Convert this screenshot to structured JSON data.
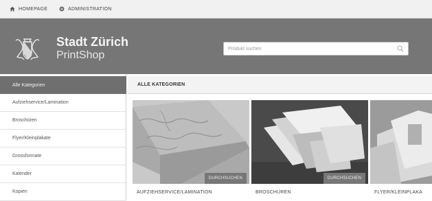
{
  "topbar": {
    "home_label": "HOMEPAGE",
    "admin_label": "ADMINISTRATION"
  },
  "header": {
    "brand_title": "Stadt Zürich",
    "brand_subtitle": "PrintShop",
    "search_placeholder": "Produkt suchen"
  },
  "sidebar": {
    "items": [
      {
        "label": "Alle Kategorien",
        "active": true
      },
      {
        "label": "Aufziehservice/Lamination"
      },
      {
        "label": "Broschüren"
      },
      {
        "label": "Flyer/Kleinplakate"
      },
      {
        "label": "Grossformate"
      },
      {
        "label": "Kalender"
      },
      {
        "label": "Kopien"
      }
    ]
  },
  "content": {
    "heading": "ALLE KATEGORIEN",
    "cards": [
      {
        "label": "AUFZIEHSERVICE/LAMINATION",
        "button": "DURCHSUCHEN"
      },
      {
        "label": "BROSCHÜREN",
        "button": "DURCHSUCHEN"
      },
      {
        "label": "FLYER/KLEINPLAKA"
      }
    ]
  },
  "colors": {
    "header_bg": "#767676",
    "active_item_bg": "#6f6f6f",
    "button_bg": "#777777"
  }
}
